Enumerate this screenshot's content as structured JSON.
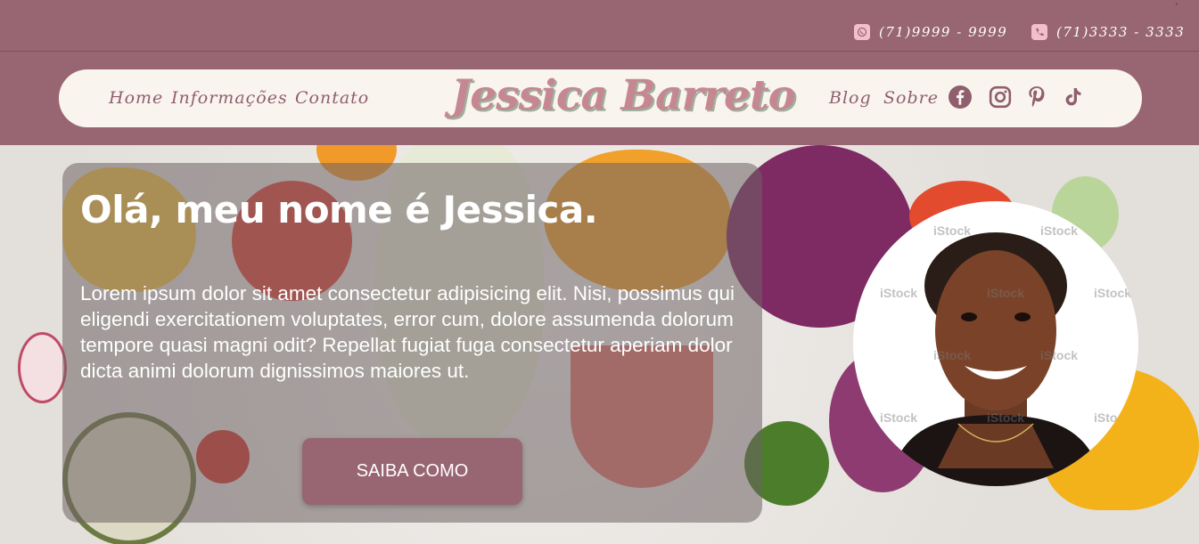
{
  "topbar": {
    "whatsapp": {
      "icon": "whatsapp-icon",
      "number": "(71)9999 - 9999"
    },
    "phone": {
      "icon": "phone-icon",
      "number": "(71)3333 - 3333"
    }
  },
  "nav": {
    "left_links": [
      "Home",
      "Informações",
      "Contato"
    ],
    "brand": "Jessica Barreto",
    "right_links": [
      "Blog",
      "Sobre"
    ],
    "social_icons": [
      "facebook-icon",
      "instagram-icon",
      "pinterest-icon",
      "tiktok-icon"
    ]
  },
  "hero": {
    "title": "Olá, meu nome é Jessica.",
    "text": "Lorem ipsum dolor sit amet consectetur adipisicing elit. Nisi, possimus qui eligendi exercitationem voluptates, error cum, dolore assumenda dolorum tempore quasi magni odit? Repellat fugiat fuga consectetur aperiam dolor dicta animi dolorum dignissimos maiores ut.",
    "cta": "SAIBA COMO",
    "photo_watermark": "iStock"
  },
  "colors": {
    "brand_mauve": "#986573",
    "nav_background": "#faf4ef",
    "brand_text": "#c58893",
    "accent_pink": "#f3bfd0"
  }
}
